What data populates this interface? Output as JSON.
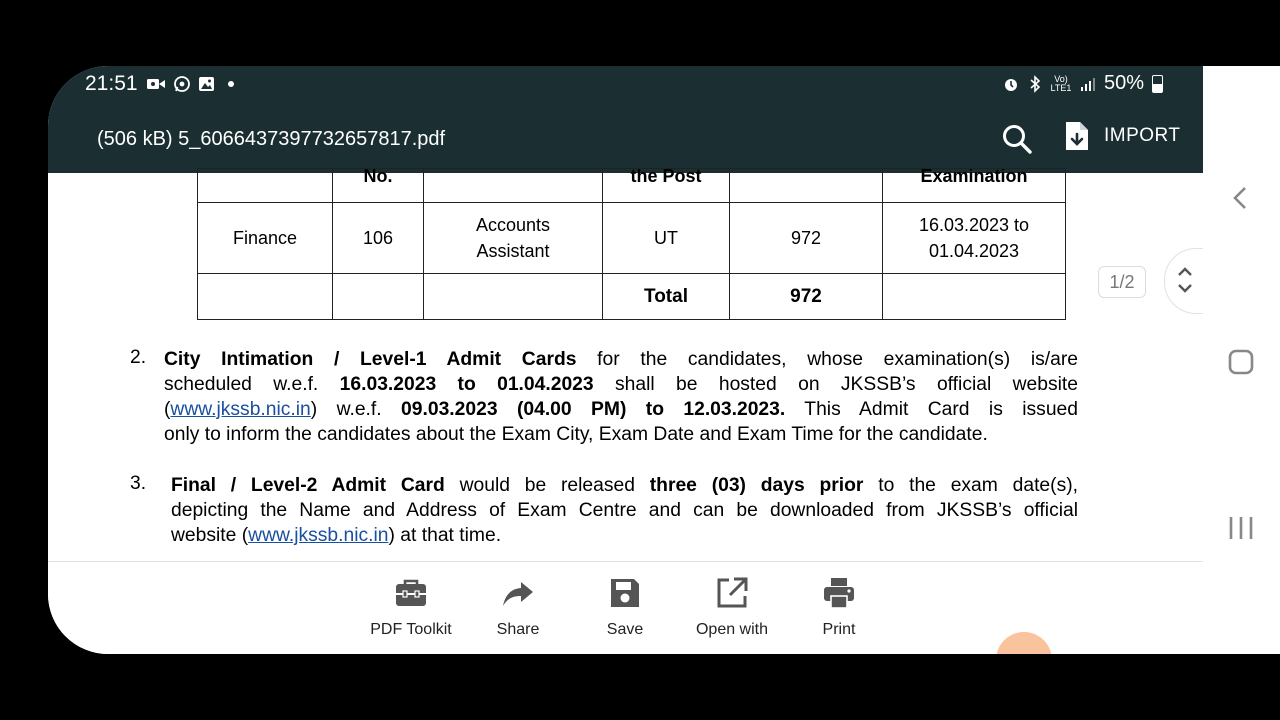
{
  "status": {
    "time": "21:51",
    "battery": "50%",
    "signal": "Vo) LTE1"
  },
  "app": {
    "title": "(506 kB) 5_6066437397732657817.pdf",
    "import_label": "IMPORT"
  },
  "document": {
    "table": {
      "header_fragments": [
        "No.",
        "the Post",
        "Examination"
      ],
      "row": {
        "department": "Finance",
        "code": "106",
        "post": "Accounts Assistant",
        "post_line1": "Accounts",
        "post_line2": "Assistant",
        "level": "UT",
        "vacancies": "972",
        "period_line1": "16.03.2023 to",
        "period_line2": "01.04.2023"
      },
      "total": {
        "label": "Total",
        "value": "972"
      }
    },
    "point2": {
      "number": "2.",
      "l1_bold": "City Intimation / Level-1 Admit Cards",
      "l1_rest": " for the candidates, whose examination(s) is/are",
      "l2_a": "scheduled w.e.f. ",
      "l2_bold": "16.03.2023 to 01.04.2023",
      "l2_b": " shall be hosted on JKSSB’s official website",
      "l3_open": "(",
      "l3_link": "www.jkssb.nic.in",
      "l3_mid": ") w.e.f. ",
      "l3_bold": "09.03.2023 (04.00 PM) to 12.03.2023.",
      "l3_rest": " This Admit Card is issued",
      "l4": "only to inform the candidates about the Exam City, Exam Date and Exam Time for the candidate."
    },
    "point3": {
      "number": "3.",
      "l1_bold1": "Final / Level-2 Admit Card",
      "l1_mid": " would be released ",
      "l1_bold2": "three (03) days prior",
      "l1_rest": " to the exam date(s),",
      "l2": "depicting the Name and Address of Exam Centre and can be downloaded from JKSSB’s official",
      "l3_a": "website (",
      "l3_link": "www.jkssb.nic.in",
      "l3_b": ") at that time."
    }
  },
  "page_indicator": "1/2",
  "toolbar": {
    "pdf_toolkit": "PDF Toolkit",
    "share": "Share",
    "save": "Save",
    "open_with": "Open with",
    "print": "Print"
  },
  "colors": {
    "header_bg": "#1b2f33",
    "link": "#1a4fa0",
    "fab": "#f7b98c"
  }
}
